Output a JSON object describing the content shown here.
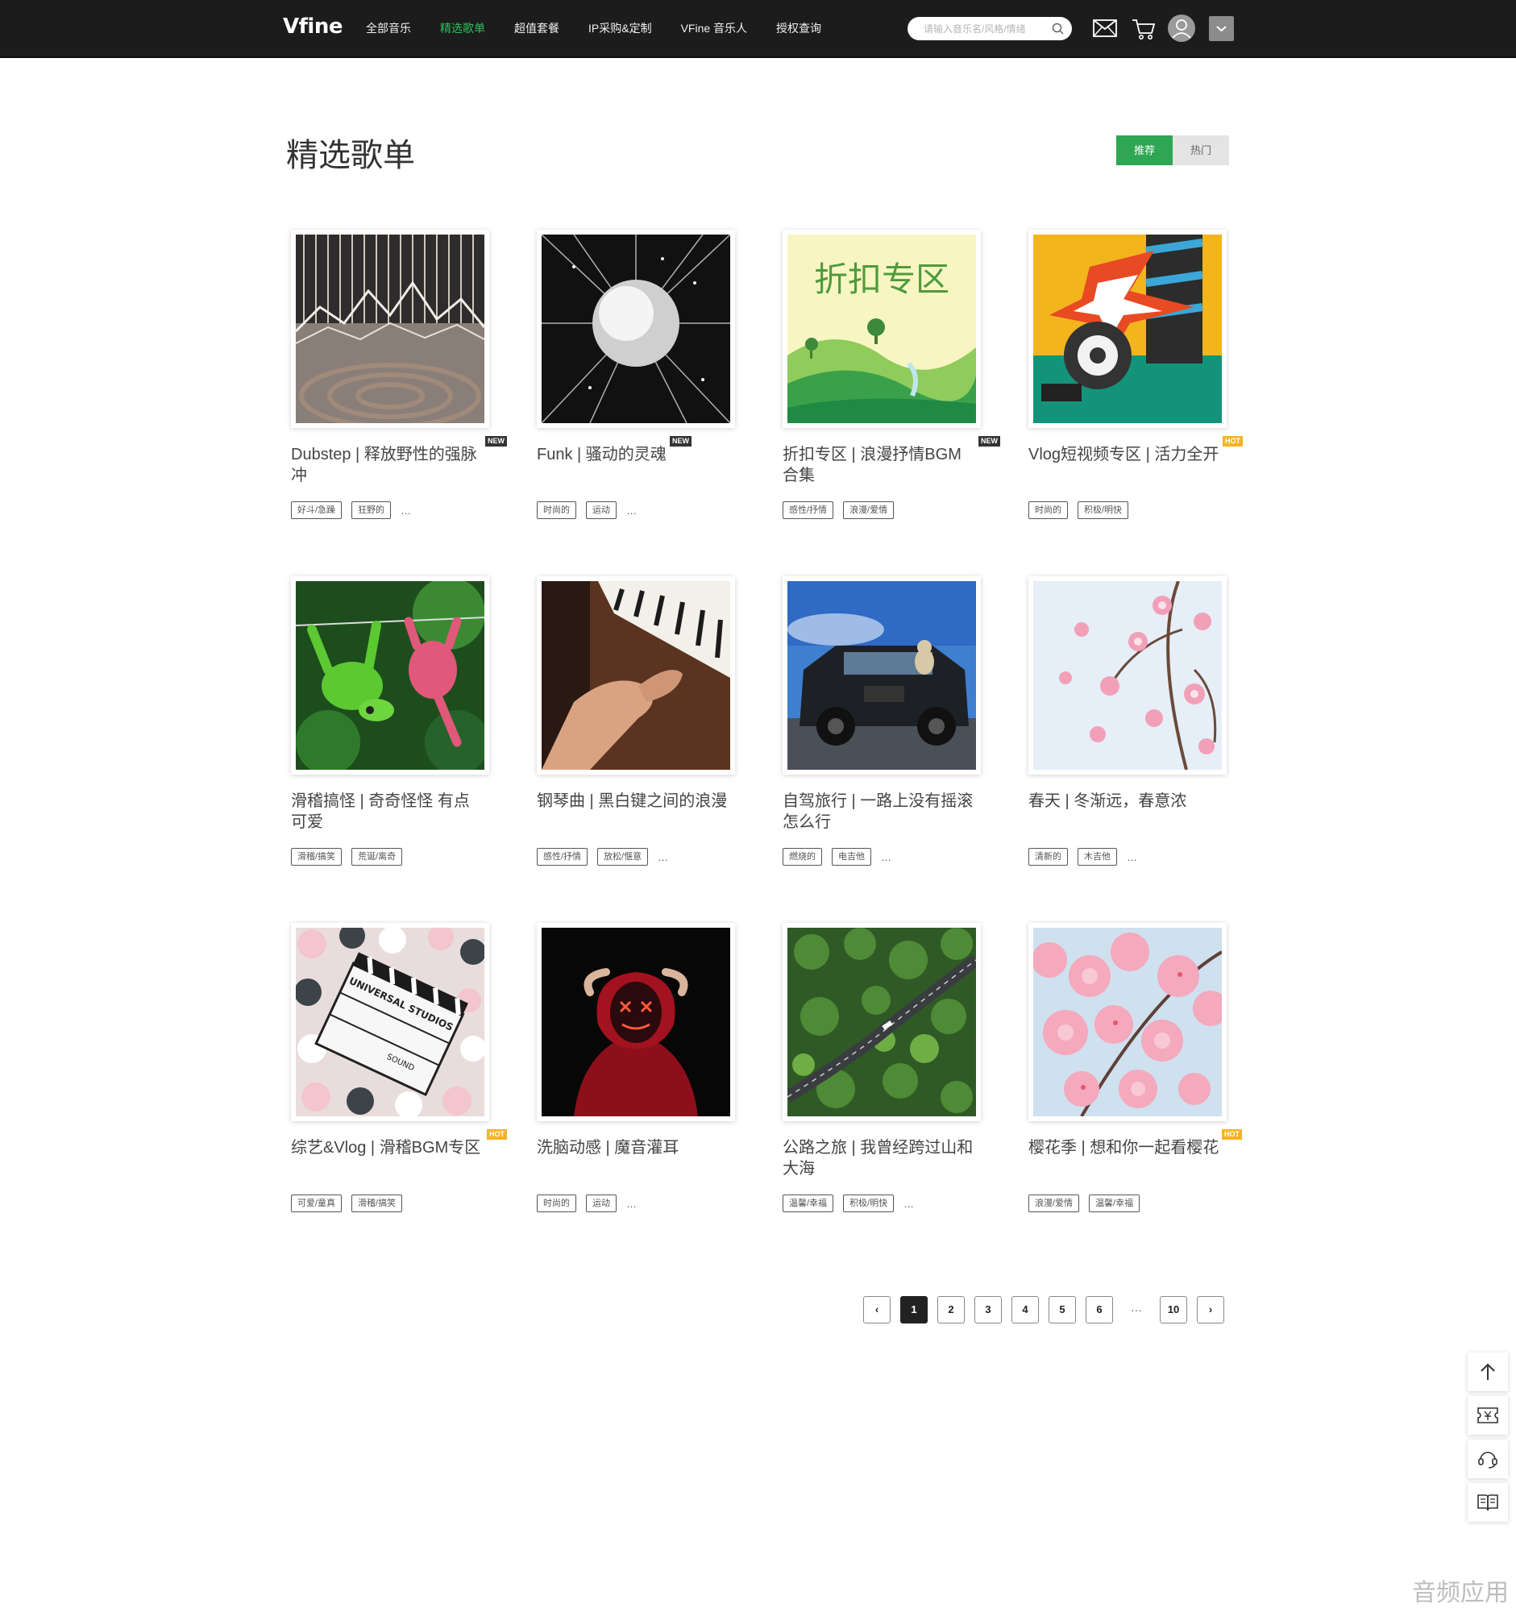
{
  "header": {
    "logo": "Vfine",
    "nav": [
      "全部音乐",
      "精选歌单",
      "超值套餐",
      "IP采购&定制",
      "VFine 音乐人",
      "授权查询"
    ],
    "active_nav": 1,
    "search_placeholder": "请输入音乐名/风格/情绪"
  },
  "page": {
    "title": "精选歌单",
    "sort_tabs": [
      "推荐",
      "热门"
    ],
    "active_sort": 0
  },
  "cards": [
    {
      "title": "Dubstep | 释放野性的强脉冲",
      "badge": "NEW",
      "tags": [
        "好斗/急躁",
        "狂野的"
      ],
      "more": "…"
    },
    {
      "title": "Funk | 骚动的灵魂",
      "badge": "NEW",
      "tags": [
        "时尚的",
        "运动"
      ],
      "more": "…"
    },
    {
      "title": "折扣专区 | 浪漫抒情BGM合集",
      "badge": "NEW",
      "tags": [
        "感性/抒情",
        "浪漫/爱情"
      ],
      "more": ""
    },
    {
      "title": "Vlog短视频专区 | 活力全开",
      "badge": "HOT",
      "tags": [
        "时尚的",
        "积极/明快"
      ],
      "more": ""
    },
    {
      "title": "滑稽搞怪 | 奇奇怪怪 有点可爱",
      "badge": "",
      "tags": [
        "滑稽/搞笑",
        "荒诞/离奇"
      ],
      "more": ""
    },
    {
      "title": "钢琴曲 | 黑白键之间的浪漫",
      "badge": "",
      "tags": [
        "感性/抒情",
        "放松/惬意"
      ],
      "more": "…"
    },
    {
      "title": "自驾旅行 | 一路上没有摇滚怎么行",
      "badge": "",
      "tags": [
        "燃烧的",
        "电吉他"
      ],
      "more": "…"
    },
    {
      "title": "春天 | 冬渐远，春意浓",
      "badge": "",
      "tags": [
        "清新的",
        "木吉他"
      ],
      "more": "…"
    },
    {
      "title": "综艺&Vlog | 滑稽BGM专区",
      "badge": "HOT",
      "tags": [
        "可爱/童真",
        "滑稽/搞笑"
      ],
      "more": ""
    },
    {
      "title": "洗脑动感 | 魔音灌耳",
      "badge": "",
      "tags": [
        "时尚的",
        "运动"
      ],
      "more": "…"
    },
    {
      "title": "公路之旅 | 我曾经跨过山和大海",
      "badge": "",
      "tags": [
        "温馨/幸福",
        "积极/明快"
      ],
      "more": "…"
    },
    {
      "title": "樱花季 | 想和你一起看樱花",
      "badge": "HOT",
      "tags": [
        "浪漫/爱情",
        "温馨/幸福"
      ],
      "more": ""
    }
  ],
  "cover_scenes": [
    "tunnel-art",
    "disco-ball",
    "green-landscape",
    "turntable-graffiti",
    "plush-toys",
    "piano-hands",
    "jeep-dog",
    "pink-blossoms",
    "clapperboard-balls",
    "masked-figure",
    "forest-road",
    "cherry-blossoms"
  ],
  "cover_texts": {
    "discount_art": "折扣专区",
    "clapper_line1": "UNIVERSAL STUDIOS",
    "clapper_line2": "SOUND"
  },
  "pagination": {
    "prev": "‹",
    "pages": [
      "1",
      "2",
      "3",
      "4",
      "5",
      "6"
    ],
    "ellipsis": "···",
    "last": "10",
    "next": "›",
    "current": "1"
  },
  "sidebar": [
    "back-to-top-icon",
    "coupon-icon",
    "customer-service-icon",
    "guide-book-icon"
  ],
  "watermark": "音频应用",
  "colors": {
    "accent_green": "#2fbf5b",
    "sort_active": "#2ea653",
    "header_bg": "#1c1c1c",
    "hot_badge": "#f5b324"
  }
}
